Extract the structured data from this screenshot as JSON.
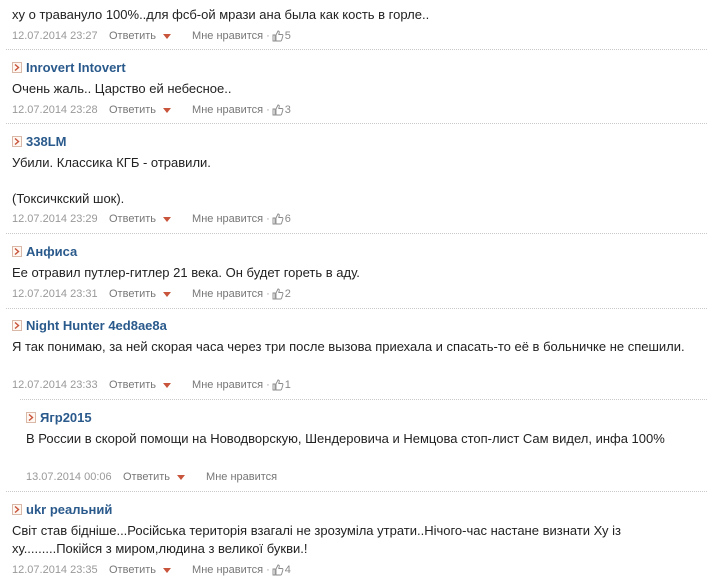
{
  "comments": [
    {
      "author": "",
      "text": "ху о травануло 100%..для фсб-ой мрази ана была как кость в горле..",
      "date": "12.07.2014 23:27",
      "reply_label": "Ответить",
      "like_label": "Мне нравится",
      "likes": "5"
    },
    {
      "author": "Inrovert Intovert",
      "text": "Очень жаль.. Царство ей небесное..",
      "date": "12.07.2014 23:28",
      "reply_label": "Ответить",
      "like_label": "Мне нравится",
      "likes": "3"
    },
    {
      "author": "338LM",
      "text": "Убили. Классика КГБ - отравили.",
      "text2": "(Токсичкский шок).",
      "date": "12.07.2014 23:29",
      "reply_label": "Ответить",
      "like_label": "Мне нравится",
      "likes": "6"
    },
    {
      "author": "Анфиса",
      "text": "Ее отравил путлер-гитлер 21 века. Он будет гореть в аду.",
      "date": "12.07.2014 23:31",
      "reply_label": "Ответить",
      "like_label": "Мне нравится",
      "likes": "2"
    },
    {
      "author": "Night Hunter 4ed8ae8a",
      "text": "Я так понимаю, за ней скорая часа через три после вызова приехала и спасать-то её в больничке не спешили.",
      "date": "12.07.2014 23:33",
      "reply_label": "Ответить",
      "like_label": "Мне нравится",
      "likes": "1"
    },
    {
      "author": "Ягр2015",
      "text": "В России в скорой помощи на Новодворскую, Шендеровича и Немцова стоп-лист Сам видел, инфа 100%",
      "date": "13.07.2014 00:06",
      "reply_label": "Ответить",
      "like_label": "Мне нравится",
      "likes": ""
    },
    {
      "author": "ukr реальний",
      "text": "Світ став бідніше...Російська територія взагалі не зрозуміла утрати..Нічого-час настане визнати Ху із ху.........Покійся з миром,людина з великої букви.!",
      "date": "12.07.2014 23:35",
      "reply_label": "Ответить",
      "like_label": "Мне нравится",
      "likes": "4"
    }
  ],
  "colors": {
    "author": "#2a5a8c",
    "accent": "#c8553b",
    "meta": "#999999",
    "separator": "#c9c9c9"
  },
  "icons": {
    "marker": "chevron-right-icon",
    "reply_menu": "triangle-down-icon",
    "like": "thumbs-up-icon"
  }
}
